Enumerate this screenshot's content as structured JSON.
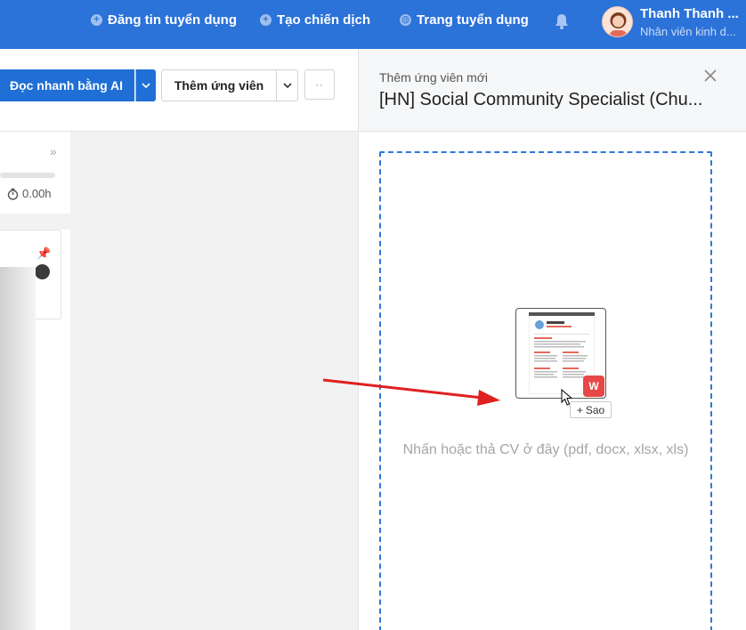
{
  "nav": {
    "items": [
      {
        "label": "Đăng tin tuyển dụng",
        "icon": "plus-circle-icon"
      },
      {
        "label": "Tạo chiến dịch",
        "icon": "plus-circle-icon"
      },
      {
        "label": "Trang tuyển dụng",
        "icon": "globe-icon"
      }
    ],
    "user": {
      "name": "Thanh Thanh ...",
      "role": "Nhân viên kinh d..."
    }
  },
  "toolbar": {
    "ai_label": "Đọc nhanh bằng AI",
    "add_label": "Thêm ứng viên",
    "more_label": "··"
  },
  "column": {
    "duration": "0.00h"
  },
  "panel": {
    "subtitle": "Thêm ứng viên mới",
    "title": "[HN] Social Community Specialist (Chu...",
    "hint": "Nhấn hoặc thả CV ở đây (pdf, docx, xlsx, xls)",
    "drag_badge": "Sao",
    "file_icon": "wps-icon"
  },
  "colors": {
    "brand": "#2b72d9",
    "button": "#1f6fd6",
    "drop_border": "#2f77dc",
    "arrow": "#e02020"
  }
}
